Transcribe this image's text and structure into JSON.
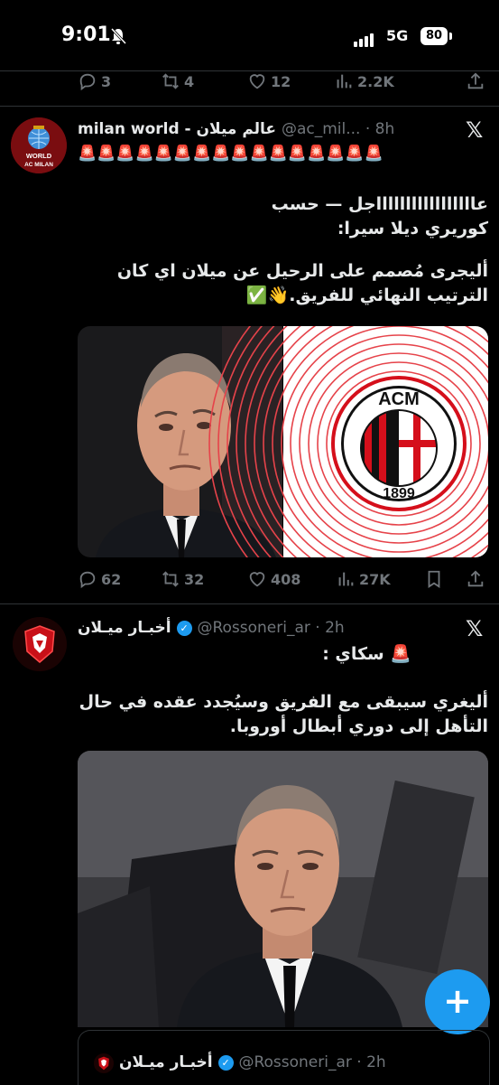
{
  "status_bar": {
    "time": "9:01",
    "network": "5G",
    "battery": "80"
  },
  "prev_tweet_actions": {
    "replies": "3",
    "retweets": "4",
    "likes": "12",
    "views": "2.2K"
  },
  "tweet1": {
    "name": "milan world - عالم ميلان",
    "handle": "@ac_mil... · 8h",
    "emoji_row": "🚨🚨🚨🚨🚨🚨🚨🚨🚨🚨🚨🚨🚨🚨🚨🚨",
    "text_line1": "عاااااااااااااااااجل — حسب",
    "text_line2": "كوريري ديلا سيرا:",
    "text_line3": "أليجرى مُصمم على الرحيل عن ميلان اي كان",
    "text_line4": "الترتيب النهائي للفريق.👋✅",
    "badge_line1": "1899",
    "badge_top": "ACM",
    "avatar_text1": "WORLD",
    "avatar_text2": "AC MILAN",
    "actions": {
      "replies": "62",
      "retweets": "32",
      "likes": "408",
      "views": "27K"
    }
  },
  "tweet2": {
    "name": "أخبـار ميـلان",
    "handle": "@Rossoneri_ar · 2h",
    "line1": "🚨 سكاي :",
    "text_line1": "أليغري سيبقى مع الفريق وسيُجدد عقده في حال",
    "text_line2": "التأهل إلى دوري أبطال أوروبا."
  },
  "quoted": {
    "name": "أخبـار ميـلان",
    "handle": "@Rossoneri_ar · 2h"
  },
  "fab_label": "+",
  "colors": {
    "accent": "#1d9bf0",
    "milan_red": "#e0141e",
    "secondary_text": "#71767b"
  }
}
